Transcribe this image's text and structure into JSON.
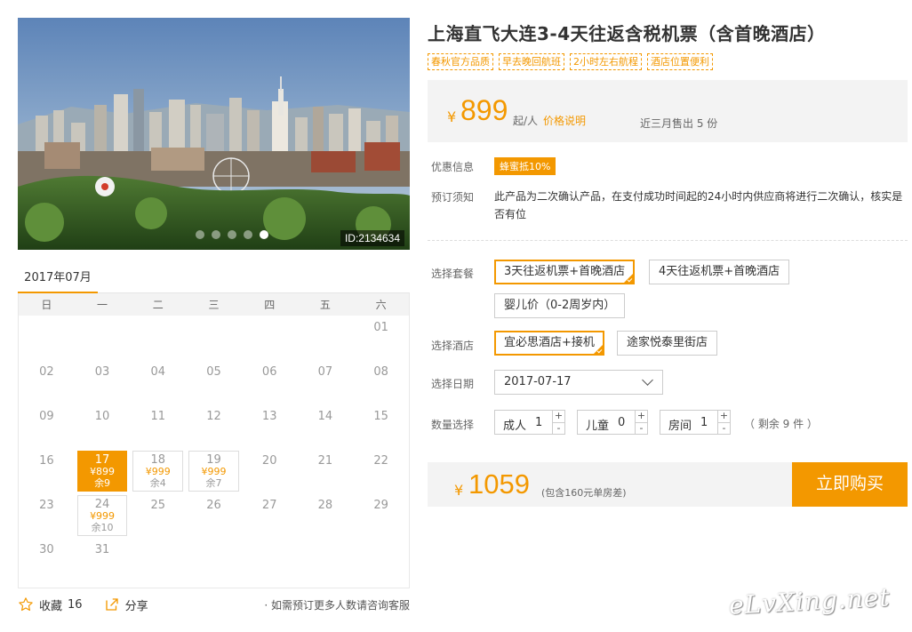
{
  "photo": {
    "id_label": "ID:2134634",
    "slide_count": 5,
    "active_slide": 5
  },
  "calendar": {
    "month": "2017年07月",
    "weekdays": [
      "日",
      "一",
      "二",
      "三",
      "四",
      "五",
      "六"
    ],
    "days": [
      {
        "day": ""
      },
      {
        "day": ""
      },
      {
        "day": ""
      },
      {
        "day": ""
      },
      {
        "day": ""
      },
      {
        "day": ""
      },
      {
        "day": "01"
      },
      {
        "day": "02"
      },
      {
        "day": "03"
      },
      {
        "day": "04"
      },
      {
        "day": "05"
      },
      {
        "day": "06"
      },
      {
        "day": "07"
      },
      {
        "day": "08"
      },
      {
        "day": "09"
      },
      {
        "day": "10"
      },
      {
        "day": "11"
      },
      {
        "day": "12"
      },
      {
        "day": "13"
      },
      {
        "day": "14"
      },
      {
        "day": "15"
      },
      {
        "day": "16"
      },
      {
        "day": "17",
        "price": "¥899",
        "stock": "余9",
        "selected": true
      },
      {
        "day": "18",
        "price": "¥999",
        "stock": "余4"
      },
      {
        "day": "19",
        "price": "¥999",
        "stock": "余7"
      },
      {
        "day": "20"
      },
      {
        "day": "21"
      },
      {
        "day": "22"
      },
      {
        "day": "23"
      },
      {
        "day": "24",
        "price": "¥999",
        "stock": "余10"
      },
      {
        "day": "25"
      },
      {
        "day": "26"
      },
      {
        "day": "27"
      },
      {
        "day": "28"
      },
      {
        "day": "29"
      },
      {
        "day": "30"
      },
      {
        "day": "31"
      }
    ]
  },
  "actions": {
    "favorite_label": "收藏",
    "favorite_count": "16",
    "share_label": "分享",
    "note": "· 如需预订更多人数请咨询客服"
  },
  "product": {
    "title": "上海直飞大连3-4天往返含税机票（含首晚酒店）",
    "tags": [
      "春秋官方品质",
      "早去晚回航班",
      "2小时左右航程",
      "酒店位置便利"
    ]
  },
  "price": {
    "currency": "¥",
    "amount": "899",
    "unit": "起/人",
    "explain_link": "价格说明",
    "sold": "近三月售出 5 份"
  },
  "promo": {
    "label": "优惠信息",
    "badge": "蜂蜜抵10%"
  },
  "notice": {
    "label": "预订须知",
    "text": "此产品为二次确认产品，在支付成功时间起的24小时内供应商将进行二次确认，核实是否有位"
  },
  "package": {
    "label": "选择套餐",
    "options": [
      "3天往返机票+首晚酒店",
      "4天往返机票+首晚酒店",
      "婴儿价（0-2周岁内）"
    ],
    "selected": 0
  },
  "hotel": {
    "label": "选择酒店",
    "options": [
      "宜必思酒店+接机",
      "途家悦泰里街店"
    ],
    "selected": 0
  },
  "date": {
    "label": "选择日期",
    "value": "2017-07-17"
  },
  "quantity": {
    "label": "数量选择",
    "adult_label": "成人",
    "adult_value": "1",
    "child_label": "儿童",
    "child_value": "0",
    "room_label": "房间",
    "room_value": "1",
    "remaining": "（ 剩余 9 件 ）"
  },
  "total": {
    "currency": "¥",
    "amount": "1059",
    "note": "(包含160元单房差)",
    "buy_label": "立即购买"
  },
  "watermark": "eLvXing.net",
  "colors": {
    "accent": "#f39800",
    "panel": "#f3f3f3"
  }
}
